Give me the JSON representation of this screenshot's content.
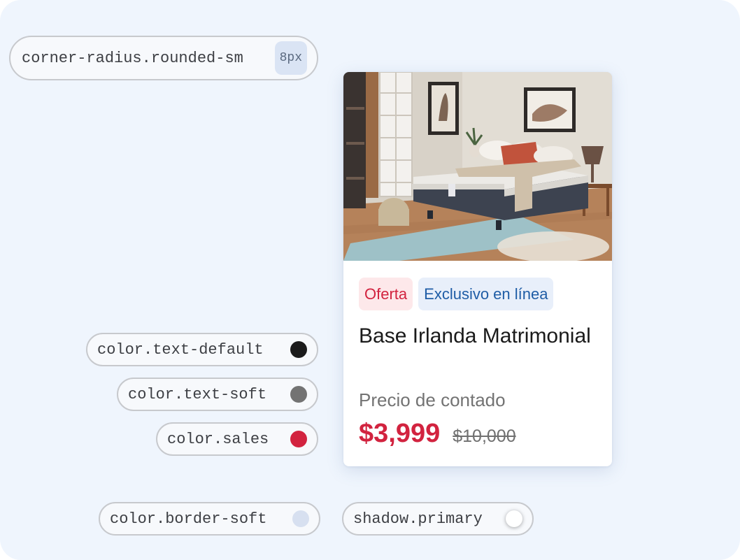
{
  "tokens": {
    "radius": {
      "label": "corner-radius.rounded-sm",
      "value": "8px"
    },
    "text_default": {
      "label": "color.text-default",
      "color": "#1b1b1b"
    },
    "text_soft": {
      "label": "color.text-soft",
      "color": "#737373"
    },
    "sales": {
      "label": "color.sales",
      "color": "#d2233f"
    },
    "border_soft": {
      "label": "color.border-soft",
      "color": "#d7e0f0"
    },
    "shadow": {
      "label": "shadow.primary",
      "color": "#ffffff"
    }
  },
  "card": {
    "image_icon": "bedroom-photo",
    "badges": [
      "Oferta",
      "Exclusivo en línea"
    ],
    "title": "Base Irlanda Matrimonial",
    "subtitle": "Precio de contado",
    "price": "$3,999",
    "old_price": "$10,000"
  }
}
